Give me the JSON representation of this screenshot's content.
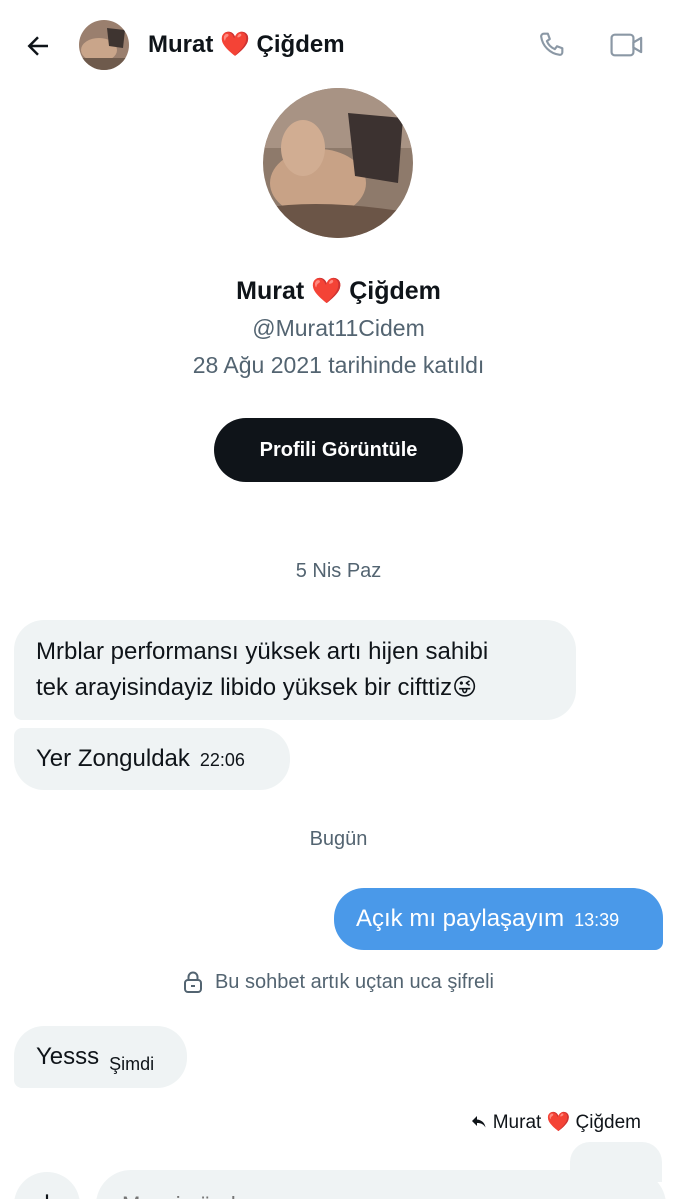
{
  "header": {
    "contact_name": "Murat ❤️ Çiğdem",
    "icons": {
      "back": "arrow-left-icon",
      "phone": "phone-icon",
      "video": "video-camera-icon"
    }
  },
  "profile": {
    "name": "Murat ❤️ Çiğdem",
    "handle": "@Murat11Cidem",
    "joined": "28 Ağu 2021 tarihinde katıldı",
    "view_button": "Profili Görüntüle"
  },
  "conversation": {
    "date_1": "5 Nis Paz",
    "msg_1_line_1": "Mrblar performansı yüksek artı hijen  sahibi",
    "msg_1_line_2": "tek arayisindayiz  libido yüksek bir cifttiz😜",
    "msg_2_text": "Yer Zonguldak",
    "msg_2_time": "22:06",
    "date_2": "Bugün",
    "msg_3_text": "Açık mı paylaşayım",
    "msg_3_time": "13:39",
    "encryption_note": "Bu sohbet artık uçtan uca şifreli",
    "msg_4_text": "Yesss",
    "msg_4_time": "Şimdi",
    "reply_to": "Murat ❤️ Çiğdem"
  },
  "composer": {
    "placeholder": "Mesaj gönder"
  },
  "colors": {
    "incoming_bubble": "#eff3f4",
    "outgoing_bubble": "#4a99e9",
    "secondary_text": "#536471",
    "button_dark": "#0f1419"
  }
}
